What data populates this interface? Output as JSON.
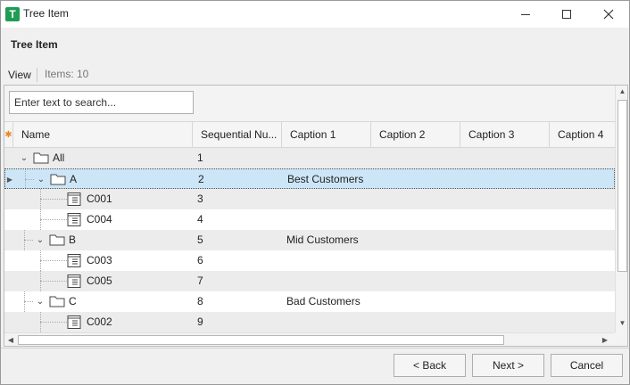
{
  "window": {
    "title": "Tree Item",
    "app_icon_letter": "T",
    "controls": {
      "minimize": "—",
      "maximize": "☐",
      "close": "✕"
    }
  },
  "header": {
    "title": "Tree Item"
  },
  "viewbar": {
    "view_label": "View",
    "items_count": "Items: 10"
  },
  "search": {
    "placeholder": "Enter text to search..."
  },
  "grid": {
    "new_row_marker": "✱",
    "columns": [
      "Name",
      "Sequential Nu...",
      "Caption 1",
      "Caption 2",
      "Caption 3",
      "Caption 4"
    ],
    "rows": [
      {
        "name": "All",
        "seq": "1",
        "caption1": "",
        "kind": "folder",
        "level": 0,
        "expanded": true
      },
      {
        "name": "A",
        "seq": "2",
        "caption1": "Best Customers",
        "kind": "folder",
        "level": 1,
        "expanded": true,
        "selected": true
      },
      {
        "name": "C001",
        "seq": "3",
        "caption1": "",
        "kind": "item",
        "level": 2
      },
      {
        "name": "C004",
        "seq": "4",
        "caption1": "",
        "kind": "item",
        "level": 2
      },
      {
        "name": "B",
        "seq": "5",
        "caption1": "Mid Customers",
        "kind": "folder",
        "level": 1,
        "expanded": true
      },
      {
        "name": "C003",
        "seq": "6",
        "caption1": "",
        "kind": "item",
        "level": 2
      },
      {
        "name": "C005",
        "seq": "7",
        "caption1": "",
        "kind": "item",
        "level": 2
      },
      {
        "name": "C",
        "seq": "8",
        "caption1": "Bad Customers",
        "kind": "folder",
        "level": 1,
        "expanded": true
      },
      {
        "name": "C002",
        "seq": "9",
        "caption1": "",
        "kind": "item",
        "level": 2
      }
    ]
  },
  "buttons": {
    "back": "< Back",
    "next": "Next >",
    "cancel": "Cancel"
  },
  "colors": {
    "accent": "#1f9d55",
    "selected_row": "#cde6f7",
    "new_row_marker": "#e8891f"
  }
}
